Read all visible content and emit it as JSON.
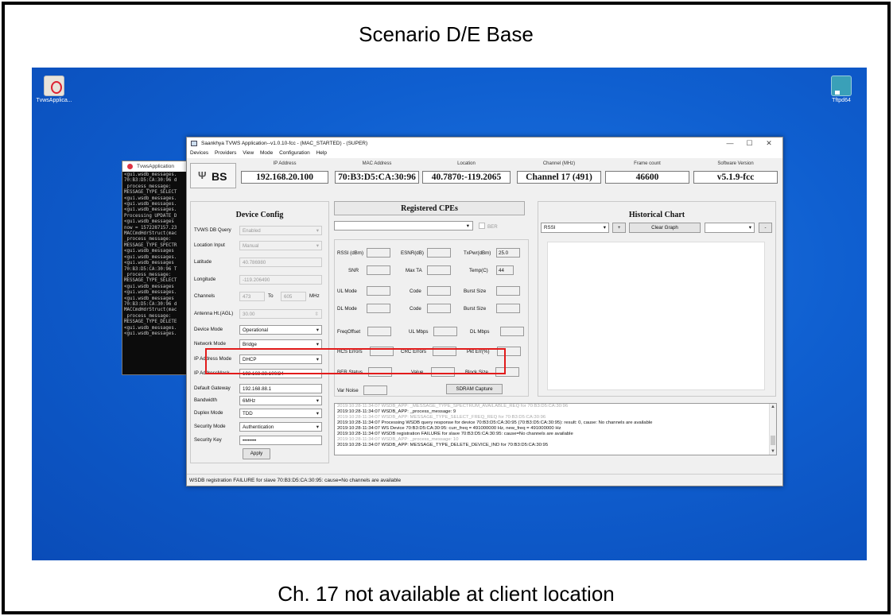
{
  "slide": {
    "title": "Scenario D/E Base",
    "caption": "Ch. 17 not available at client location"
  },
  "desktop": {
    "icons": [
      {
        "label": "TvwsApplica...",
        "icon": "tvws-application-icon"
      },
      {
        "label": "Tftpd64",
        "icon": "tftpd64-icon"
      }
    ],
    "colors": {
      "background": "#0f5fd0"
    }
  },
  "terminal": {
    "title": "TvwsApplication",
    "lines": [
      "<gui.wsdb_messages.",
      "70:B3:D5:CA:30:96 d",
      "_process_message:",
      "MESSAGE_TYPE_SELECT",
      "<gui.wsdb_messages.",
      "<gui.wsdb_messages.",
      "<gui.wsdb_messages.",
      "Processing UPDATE_D",
      "<gui.wsdb_messages",
      "now = 1572287157.23",
      "MACCmdHdrStruct(mac",
      "_process_message:",
      "MESSAGE_TYPE_SPECTR",
      "<gui.wsdb_messages",
      "<gui.wsdb_messages.",
      "<gui.wsdb_messages",
      "70:B3:D5:CA:30:96 T",
      "_process_message:",
      "MESSAGE_TYPE_SELECT",
      "<gui.wsdb_messages",
      "<gui.wsdb_messages.",
      "<gui.wsdb_messages",
      "70:B3:D5:CA:30:96 d",
      "MACCmdHdrStruct(mac",
      "_process_message:",
      "MESSAGE_TYPE_DELETE",
      "<gui.wsdb_messages.",
      "<gui.wsdb_messages."
    ]
  },
  "app": {
    "title": "Saankhya TVWS Application--v1.0.10-fcc - (MAC_STARTED) - (SUPER)",
    "menu": [
      "Devices",
      "Providers",
      "View",
      "Mode",
      "Configuration",
      "Help"
    ],
    "window_controls": [
      "—",
      "☐",
      "✕"
    ],
    "logo_text": "BS",
    "header": [
      {
        "label": "IP Address",
        "value": "192.168.20.100"
      },
      {
        "label": "MAC Address",
        "value": "70:B3:D5:CA:30:96"
      },
      {
        "label": "Location",
        "value": "40.7870:-119.2065"
      },
      {
        "label": "Channel (MHz)",
        "value": "Channel 17 (491)"
      },
      {
        "label": "Frame count",
        "value": "46600"
      },
      {
        "label": "Software Version",
        "value": "v5.1.9-fcc"
      }
    ],
    "device_config": {
      "title": "Device Config",
      "fields": {
        "tvws_db_query": {
          "label": "TVWS DB Query",
          "value": "Enabled"
        },
        "location_input": {
          "label": "Location Input",
          "value": "Manual"
        },
        "latitude": {
          "label": "Latitude",
          "value": "40.786980"
        },
        "longitude": {
          "label": "Longitude",
          "value": "-119.206490"
        },
        "channels": {
          "label": "Channels",
          "from": "473",
          "to_label": "To",
          "to": "605",
          "unit": "MHz"
        },
        "antenna": {
          "label": "Antenna Ht.(AGL)",
          "value": "30.00"
        },
        "device_mode": {
          "label": "Device Mode",
          "value": "Operational"
        },
        "network_mode": {
          "label": "Network Mode",
          "value": "Bridge"
        },
        "ip_address_mode": {
          "label": "IP Address Mode",
          "value": "DHCP"
        },
        "ip_address_mask": {
          "label": "IP AddressMask",
          "value": "192.168.88.100/24"
        },
        "default_gateway": {
          "label": "Default Gateway",
          "value": "192.168.88.1"
        },
        "bandwidth": {
          "label": "Bandwidth",
          "value": "6MHz"
        },
        "duplex_mode": {
          "label": "Duplex Mode",
          "value": "TDD"
        },
        "security_mode": {
          "label": "Security Mode",
          "value": "Authentication"
        },
        "security_key": {
          "label": "Security Key",
          "value": "••••••••"
        }
      },
      "apply_label": "Apply"
    },
    "registered_cpes": {
      "title": "Registered CPEs",
      "ber_label": "BER",
      "fields": {
        "rssi": {
          "label": "RSSI (dBm)",
          "value": ""
        },
        "esnr": {
          "label": "ESNR(dB)",
          "value": ""
        },
        "txpwr": {
          "label": "TxPwr(dBm)",
          "value": "25.0"
        },
        "snr": {
          "label": "SNR",
          "value": ""
        },
        "max_ta": {
          "label": "Max TA",
          "value": ""
        },
        "temp": {
          "label": "Temp(C)",
          "value": "44"
        },
        "ul_mode": {
          "label": "UL Mode",
          "value": ""
        },
        "ul_code": {
          "label": "Code",
          "value": ""
        },
        "ul_burst": {
          "label": "Burst Size",
          "value": ""
        },
        "dl_mode": {
          "label": "DL Mode",
          "value": ""
        },
        "dl_code": {
          "label": "Code",
          "value": ""
        },
        "dl_burst": {
          "label": "Burst Size",
          "value": ""
        },
        "freq_offset": {
          "label": "FreqOffset",
          "value": ""
        },
        "ul_mbps": {
          "label": "UL Mbps",
          "value": ""
        },
        "dl_mbps": {
          "label": "DL Mbps",
          "value": ""
        },
        "hcs_errors": {
          "label": "HCS Errors",
          "value": ""
        },
        "crc_errors": {
          "label": "CRC Errors",
          "value": ""
        },
        "pkt_err": {
          "label": "Pkt Err(%)",
          "value": ""
        },
        "ber_status": {
          "label": "BER Status",
          "value": ""
        },
        "ber_value": {
          "label": "Value",
          "value": ""
        },
        "block_size": {
          "label": "Block Size",
          "value": ""
        },
        "var_noise": {
          "label": "Var Noise",
          "value": ""
        }
      },
      "sdram_label": "SDRAM Capture"
    },
    "historical_chart": {
      "title": "Historical Chart",
      "metric": "RSSI",
      "add_label": "+",
      "clear_label": "Clear Graph",
      "remove_label": "-"
    },
    "log": [
      {
        "text": "2019:10:28-11:34:07 WSDB_APP: _MESSAGE_TYPE_SPECTRUM_AVAILABLE_REQ for 70:B3:D5:CA:30:96",
        "faded": true
      },
      {
        "text": "2019:10:28-11:34:07 WSDB_APP: _process_message: 9",
        "faded": false
      },
      {
        "text": "2019:10:28-11:34:07 WSDB_APP: MESSAGE_TYPE_SELECT_FREQ_REQ for 70:B3:D5:CA:30:96",
        "faded": true
      },
      {
        "text": "2019:10:28-11:34:07 Processing WSDB query response for device 70:B3:D5:CA:30:95 (70:B3:D5:CA:30:95): result: 0, cause: No channels are available",
        "faded": false
      },
      {
        "text": "2019:10:28-11:34:07 WS Device 70:B3:D5:CA:30:95: curr_freq = 491000000 Hz, new_freq = 491000000 Hz",
        "faded": false
      },
      {
        "text": "2019:10:28-11:34:07 WSDB registration FAILURE for slave 70:B3:D5:CA:30:95: cause=No channels are available",
        "faded": false
      },
      {
        "text": "2019:10:28-11:34:07 WSDB_APP: _process_message: 10",
        "faded": true
      },
      {
        "text": "2019:10:28-11:34:07 WSDB_APP: MESSAGE_TYPE_DELETE_DEVICE_IND for 70:B3:D5:CA:30:95",
        "faded": false
      }
    ],
    "status": "WSDB registration FAILURE for slave 70:B3:D5:CA:30:95: cause=No channels are available",
    "colors": {
      "highlight": "#e21b1b"
    }
  }
}
